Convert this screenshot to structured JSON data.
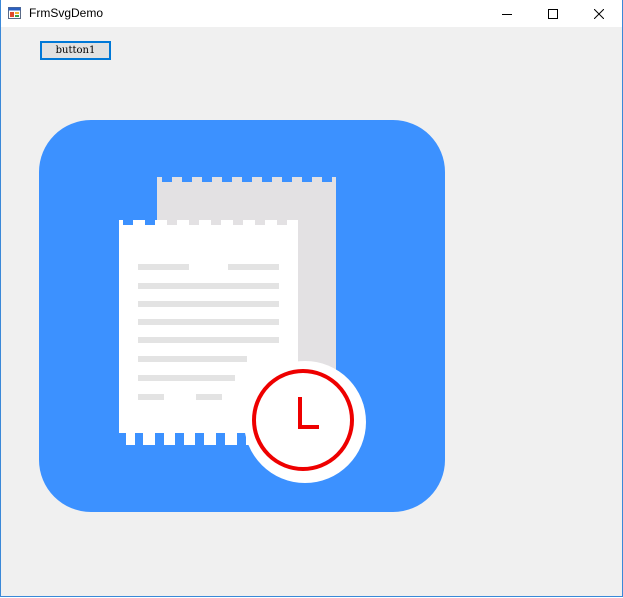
{
  "window": {
    "title": "FrmSvgDemo",
    "app_icon": "winforms-app-icon",
    "controls": {
      "minimize_icon": "minimize-icon",
      "maximize_icon": "maximize-icon",
      "close_icon": "close-icon"
    }
  },
  "form": {
    "button1_label": "button1"
  },
  "illustration": {
    "icon": "receipt-clock-icon",
    "clock_glyph": "L",
    "colors": {
      "tile": "#3c91ff",
      "back_paper": "#e3e1e3",
      "front_paper": "#ffffff",
      "paper_lines": "#e3e3e3",
      "clock_ring": "#ee0000",
      "clock_hands": "#ee0000"
    }
  }
}
